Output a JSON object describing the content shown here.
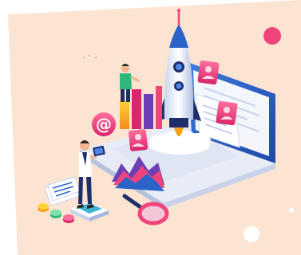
{
  "illustration": {
    "icons": {
      "rocket": "rocket-icon",
      "at_sign": "at-sign-icon",
      "magnifier": "magnifier-icon",
      "profile_card": "profile-card-icon",
      "laptop": "laptop-icon",
      "bar_chart": "bar-chart-icon",
      "area_chart": "area-chart-icon",
      "coins": "coins-icon",
      "document": "document-icon",
      "tablet": "tablet-icon"
    },
    "at_symbol": "@",
    "colors": {
      "background_panel": "#fbe4d2",
      "accent_pink": "#f0447a",
      "accent_blue": "#2a63c9",
      "navy": "#1f2d6b",
      "purple": "#6d3fb5",
      "orange": "#f6a11a",
      "green": "#2fb67a",
      "white": "#ffffff"
    }
  }
}
